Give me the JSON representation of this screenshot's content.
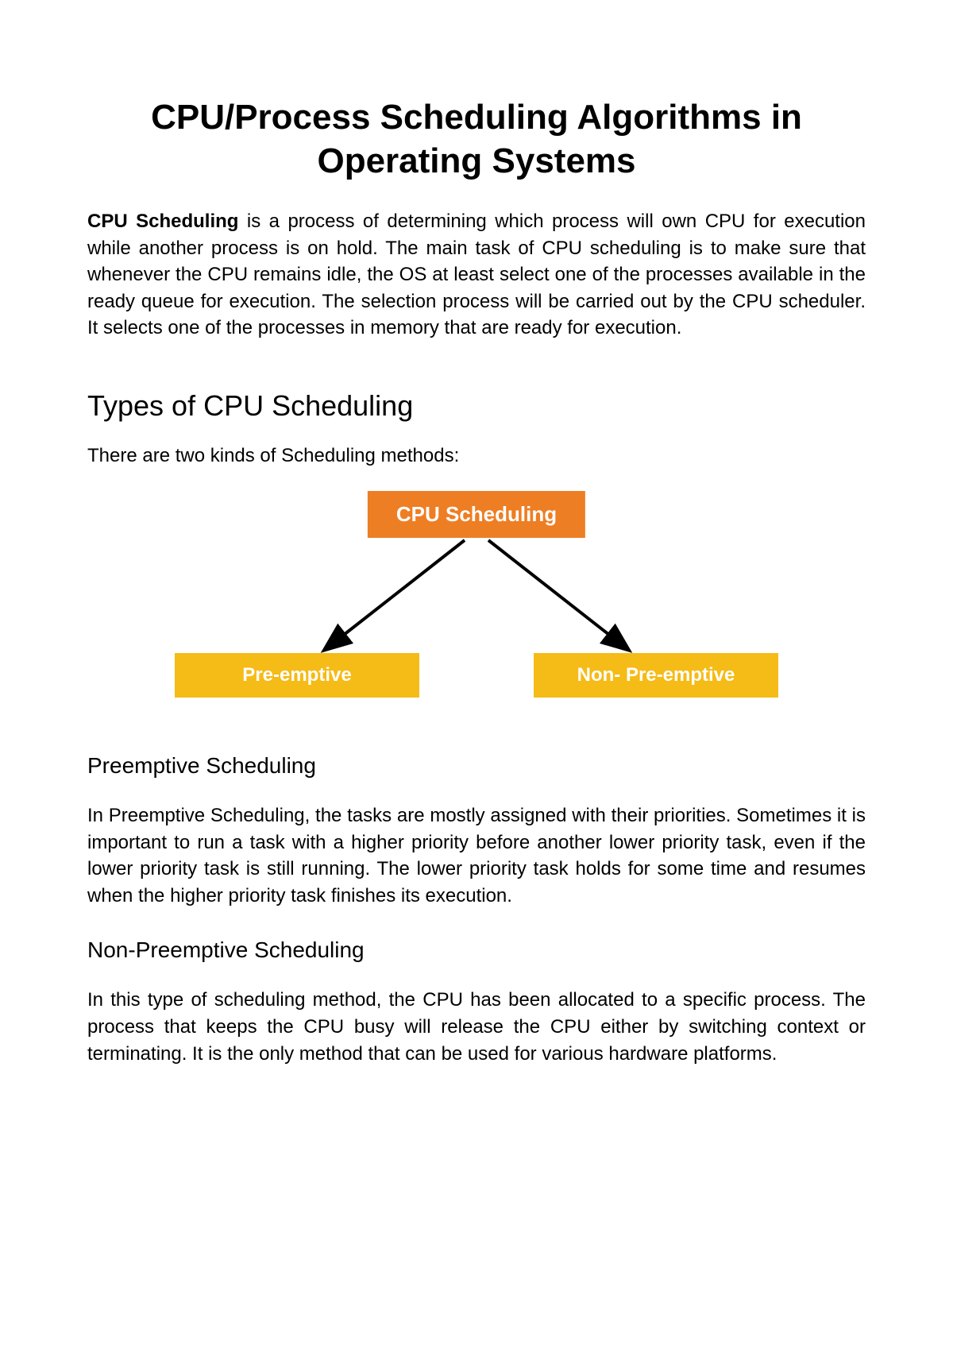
{
  "title": "CPU/Process Scheduling Algorithms in Operating Systems",
  "intro": {
    "bold": "CPU Scheduling",
    "rest": " is a process of determining which process will own CPU for execution while another process is on hold. The main task of CPU scheduling is to make sure that whenever the CPU remains idle, the OS at least select one of the processes available in the ready queue for execution. The selection process will be carried out by the CPU scheduler. It selects one of the processes in memory that are ready for execution."
  },
  "section1": {
    "heading": "Types of CPU Scheduling",
    "text": "There are two kinds of Scheduling methods:"
  },
  "diagram": {
    "top": "CPU Scheduling",
    "left": "Pre-emptive",
    "right": "Non- Pre-emptive"
  },
  "preemptive": {
    "heading": "Preemptive Scheduling",
    "text": "In Preemptive Scheduling, the tasks are mostly assigned with their priorities. Sometimes it is important to run a task with a higher priority before another lower priority task, even if the lower priority task is still running. The lower priority task holds for some time and resumes when the higher priority task finishes its execution."
  },
  "nonpreemptive": {
    "heading": "Non-Preemptive Scheduling",
    "text": "In this type of scheduling method, the CPU has been allocated to a specific process. The process that keeps the CPU busy will release the CPU either by switching context or terminating. It is the only method that can be used for various hardware platforms."
  }
}
